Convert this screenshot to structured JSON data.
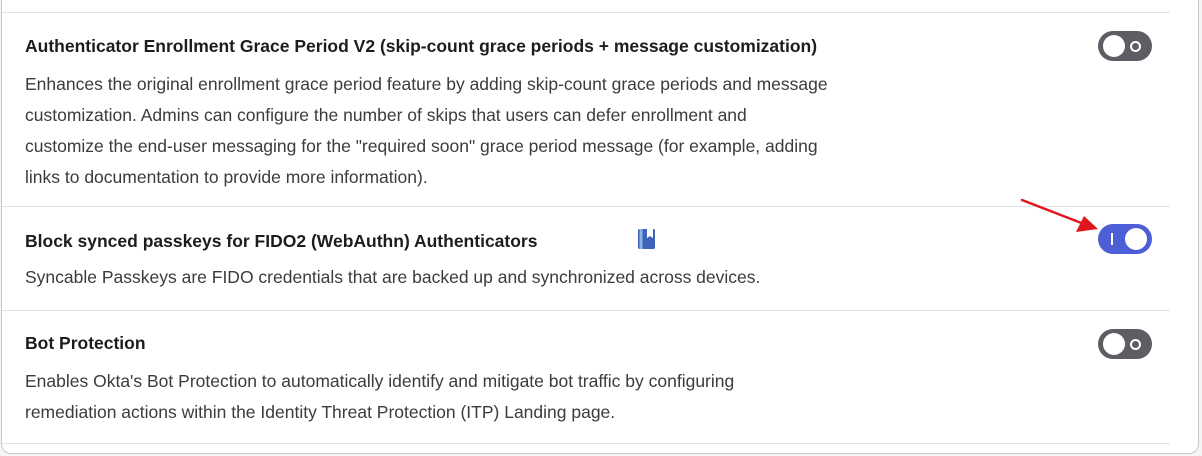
{
  "features": [
    {
      "title": "Authenticator Enrollment Grace Period V2 (skip-count grace periods + message customization)",
      "description_lines": [
        "Enhances the original enrollment grace period feature by adding skip-count grace periods and message",
        "customization. Admins can configure the number of skips that users can defer enrollment and",
        "customize the end-user messaging for the \"required soon\" grace period message (for example, adding",
        "links to documentation to provide more information)."
      ],
      "enabled": false
    },
    {
      "title": "Block synced passkeys for FIDO2 (WebAuthn) Authenticators",
      "description_lines": [
        "Syncable Passkeys are FIDO credentials that are backed up and synchronized across devices."
      ],
      "enabled": true,
      "icon": "book-icon"
    },
    {
      "title": "Bot Protection",
      "description_lines": [
        "Enables Okta's Bot Protection to automatically identify and mitigate bot traffic by configuring",
        "remediation actions within the Identity Threat Protection (ITP) Landing page."
      ],
      "enabled": false
    }
  ],
  "colors": {
    "toggle_on": "#4d5fd6",
    "toggle_off": "#5d5d64",
    "annotation_arrow": "#e0161d"
  }
}
